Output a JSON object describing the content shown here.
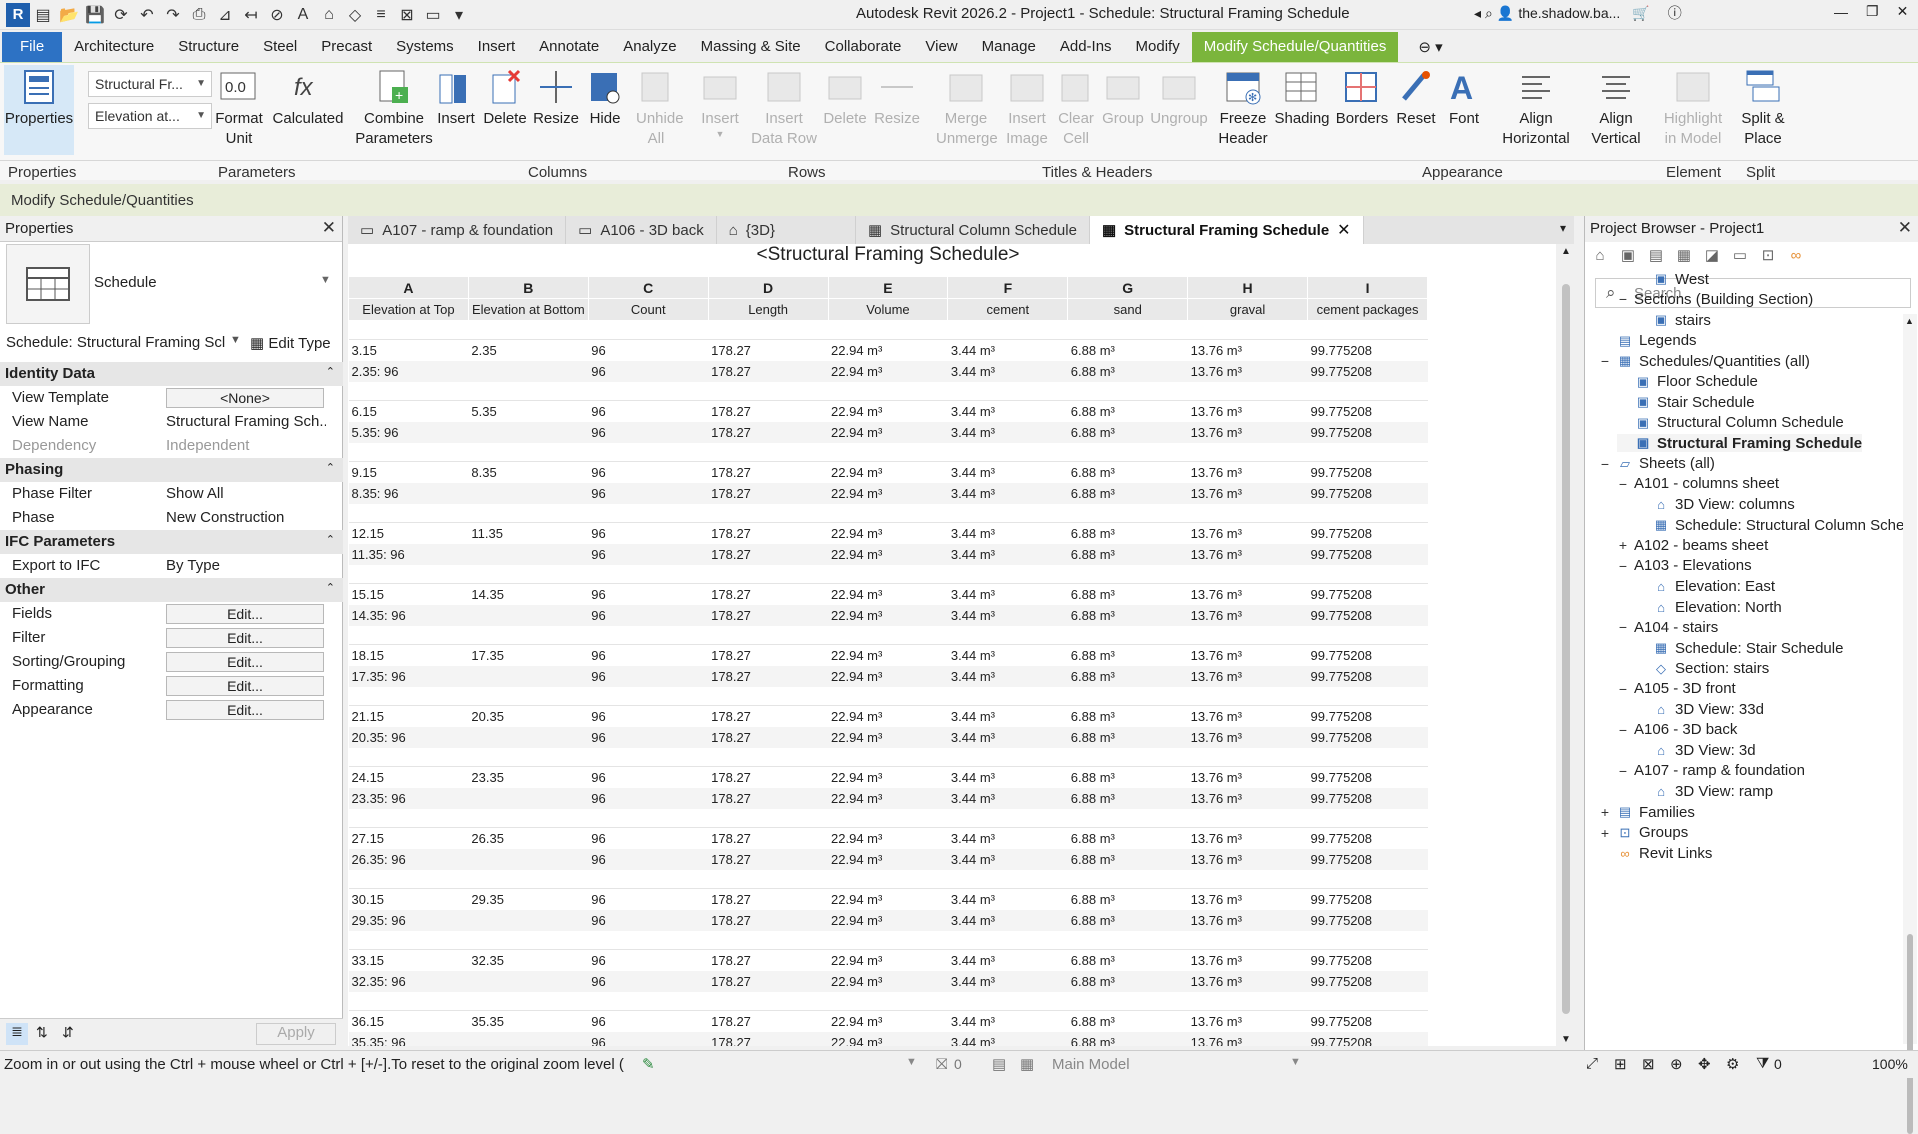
{
  "app": {
    "title": "Autodesk Revit 2026.2 - Project1 - Schedule: Structural Framing Schedule",
    "logo": "R",
    "user": "the.shadow.ba..."
  },
  "menu": [
    "File",
    "Architecture",
    "Structure",
    "Steel",
    "Precast",
    "Systems",
    "Insert",
    "Annotate",
    "Analyze",
    "Massing & Site",
    "Collaborate",
    "View",
    "Manage",
    "Add-Ins",
    "Modify",
    "Modify Schedule/Quantities"
  ],
  "ribbon": {
    "combo1": "Structural Fr...",
    "combo2": "Elevation at...",
    "buttons": {
      "properties": "Properties",
      "format_unit": "Format Unit",
      "calculated": "Calculated",
      "combine_parameters": "Combine Parameters",
      "insert": "Insert",
      "delete": "Delete",
      "resize": "Resize",
      "hide": "Hide",
      "unhide_all": "Unhide All",
      "rows_insert": "Insert",
      "insert_data_row": "Insert Data Row",
      "rows_delete": "Delete",
      "rows_resize": "Resize",
      "merge_unmerge": "Merge Unmerge",
      "insert_image": "Insert Image",
      "clear_cell": "Clear Cell",
      "group": "Group",
      "ungroup": "Ungroup",
      "freeze_header": "Freeze Header",
      "shading": "Shading",
      "borders": "Borders",
      "reset": "Reset",
      "font": "Font",
      "align_horizontal": "Align Horizontal",
      "align_vertical": "Align Vertical",
      "highlight_in_model": "Highlight in Model",
      "split_place": "Split & Place"
    },
    "panels": [
      "Properties",
      "Parameters",
      "Columns",
      "Rows",
      "Titles & Headers",
      "Appearance",
      "Element",
      "Split"
    ]
  },
  "context_bar": "Modify Schedule/Quantities",
  "properties": {
    "header": "Properties",
    "type_name": "Schedule",
    "selector": "Schedule: Structural Framing Scl",
    "edit_type": "Edit Type",
    "groups": {
      "identity": "Identity Data",
      "phasing": "Phasing",
      "ifc": "IFC Parameters",
      "other": "Other"
    },
    "rows": {
      "view_template_k": "View Template",
      "view_template_v": "<None>",
      "view_name_k": "View Name",
      "view_name_v": "Structural Framing Sch...",
      "dependency_k": "Dependency",
      "dependency_v": "Independent",
      "phase_filter_k": "Phase Filter",
      "phase_filter_v": "Show All",
      "phase_k": "Phase",
      "phase_v": "New Construction",
      "export_ifc_k": "Export to IFC",
      "export_ifc_v": "By Type",
      "fields_k": "Fields",
      "filter_k": "Filter",
      "sorting_k": "Sorting/Grouping",
      "formatting_k": "Formatting",
      "appearance_k": "Appearance",
      "edit": "Edit..."
    },
    "apply": "Apply"
  },
  "view_tabs": [
    "A107 - ramp & foundation",
    "A106 - 3D back",
    "{3D}",
    "Structural Column Schedule",
    "Structural Framing Schedule"
  ],
  "schedule": {
    "title": "<Structural Framing Schedule>",
    "letters": [
      "A",
      "B",
      "C",
      "D",
      "E",
      "F",
      "G",
      "H",
      "I"
    ],
    "headers": [
      "Elevation at Top",
      "Elevation at Bottom",
      "Count",
      "Length",
      "Volume",
      "cement",
      "sand",
      "graval",
      "cement packages"
    ],
    "groups": [
      {
        "r1": [
          "3.15",
          "2.35",
          "96",
          "178.27",
          "22.94 m³",
          "3.44 m³",
          "6.88 m³",
          "13.76 m³",
          "99.775208"
        ],
        "r2": [
          "2.35: 96",
          "",
          "96",
          "178.27",
          "22.94 m³",
          "3.44 m³",
          "6.88 m³",
          "13.76 m³",
          "99.775208"
        ]
      },
      {
        "r1": [
          "6.15",
          "5.35",
          "96",
          "178.27",
          "22.94 m³",
          "3.44 m³",
          "6.88 m³",
          "13.76 m³",
          "99.775208"
        ],
        "r2": [
          "5.35: 96",
          "",
          "96",
          "178.27",
          "22.94 m³",
          "3.44 m³",
          "6.88 m³",
          "13.76 m³",
          "99.775208"
        ]
      },
      {
        "r1": [
          "9.15",
          "8.35",
          "96",
          "178.27",
          "22.94 m³",
          "3.44 m³",
          "6.88 m³",
          "13.76 m³",
          "99.775208"
        ],
        "r2": [
          "8.35: 96",
          "",
          "96",
          "178.27",
          "22.94 m³",
          "3.44 m³",
          "6.88 m³",
          "13.76 m³",
          "99.775208"
        ]
      },
      {
        "r1": [
          "12.15",
          "11.35",
          "96",
          "178.27",
          "22.94 m³",
          "3.44 m³",
          "6.88 m³",
          "13.76 m³",
          "99.775208"
        ],
        "r2": [
          "11.35: 96",
          "",
          "96",
          "178.27",
          "22.94 m³",
          "3.44 m³",
          "6.88 m³",
          "13.76 m³",
          "99.775208"
        ]
      },
      {
        "r1": [
          "15.15",
          "14.35",
          "96",
          "178.27",
          "22.94 m³",
          "3.44 m³",
          "6.88 m³",
          "13.76 m³",
          "99.775208"
        ],
        "r2": [
          "14.35: 96",
          "",
          "96",
          "178.27",
          "22.94 m³",
          "3.44 m³",
          "6.88 m³",
          "13.76 m³",
          "99.775208"
        ]
      },
      {
        "r1": [
          "18.15",
          "17.35",
          "96",
          "178.27",
          "22.94 m³",
          "3.44 m³",
          "6.88 m³",
          "13.76 m³",
          "99.775208"
        ],
        "r2": [
          "17.35: 96",
          "",
          "96",
          "178.27",
          "22.94 m³",
          "3.44 m³",
          "6.88 m³",
          "13.76 m³",
          "99.775208"
        ]
      },
      {
        "r1": [
          "21.15",
          "20.35",
          "96",
          "178.27",
          "22.94 m³",
          "3.44 m³",
          "6.88 m³",
          "13.76 m³",
          "99.775208"
        ],
        "r2": [
          "20.35: 96",
          "",
          "96",
          "178.27",
          "22.94 m³",
          "3.44 m³",
          "6.88 m³",
          "13.76 m³",
          "99.775208"
        ]
      },
      {
        "r1": [
          "24.15",
          "23.35",
          "96",
          "178.27",
          "22.94 m³",
          "3.44 m³",
          "6.88 m³",
          "13.76 m³",
          "99.775208"
        ],
        "r2": [
          "23.35: 96",
          "",
          "96",
          "178.27",
          "22.94 m³",
          "3.44 m³",
          "6.88 m³",
          "13.76 m³",
          "99.775208"
        ]
      },
      {
        "r1": [
          "27.15",
          "26.35",
          "96",
          "178.27",
          "22.94 m³",
          "3.44 m³",
          "6.88 m³",
          "13.76 m³",
          "99.775208"
        ],
        "r2": [
          "26.35: 96",
          "",
          "96",
          "178.27",
          "22.94 m³",
          "3.44 m³",
          "6.88 m³",
          "13.76 m³",
          "99.775208"
        ]
      },
      {
        "r1": [
          "30.15",
          "29.35",
          "96",
          "178.27",
          "22.94 m³",
          "3.44 m³",
          "6.88 m³",
          "13.76 m³",
          "99.775208"
        ],
        "r2": [
          "29.35: 96",
          "",
          "96",
          "178.27",
          "22.94 m³",
          "3.44 m³",
          "6.88 m³",
          "13.76 m³",
          "99.775208"
        ]
      },
      {
        "r1": [
          "33.15",
          "32.35",
          "96",
          "178.27",
          "22.94 m³",
          "3.44 m³",
          "6.88 m³",
          "13.76 m³",
          "99.775208"
        ],
        "r2": [
          "32.35: 96",
          "",
          "96",
          "178.27",
          "22.94 m³",
          "3.44 m³",
          "6.88 m³",
          "13.76 m³",
          "99.775208"
        ]
      },
      {
        "r1": [
          "36.15",
          "35.35",
          "96",
          "178.27",
          "22.94 m³",
          "3.44 m³",
          "6.88 m³",
          "13.76 m³",
          "99.775208"
        ],
        "r2": [
          "35.35: 96",
          "",
          "96",
          "178.27",
          "22.94 m³",
          "3.44 m³",
          "6.88 m³",
          "13.76 m³",
          "99.775208"
        ]
      }
    ]
  },
  "browser": {
    "header": "Project Browser - Project1",
    "search_placeholder": "Search",
    "nodes": [
      {
        "label": "West",
        "icon": "elevation-view-icon",
        "level": 3,
        "toggle": ""
      },
      {
        "label": "Sections (Building Section)",
        "icon": "",
        "level": 2,
        "toggle": "−"
      },
      {
        "label": "stairs",
        "icon": "section-view-icon",
        "level": 3,
        "toggle": ""
      },
      {
        "label": "Legends",
        "icon": "legend-icon",
        "level": 1,
        "toggle": ""
      },
      {
        "label": "Schedules/Quantities (all)",
        "icon": "schedule-icon",
        "level": 1,
        "toggle": "−"
      },
      {
        "label": "Floor Schedule",
        "icon": "schedule-item-icon",
        "level": 2,
        "toggle": ""
      },
      {
        "label": "Stair Schedule",
        "icon": "schedule-item-icon",
        "level": 2,
        "toggle": ""
      },
      {
        "label": "Structural Column Schedule",
        "icon": "schedule-item-icon",
        "level": 2,
        "toggle": ""
      },
      {
        "label": "Structural Framing Schedule",
        "icon": "schedule-item-icon",
        "level": 2,
        "toggle": "",
        "selected": true
      },
      {
        "label": "Sheets (all)",
        "icon": "sheet-set-icon",
        "level": 1,
        "toggle": "−"
      },
      {
        "label": "A101 - columns sheet",
        "icon": "",
        "level": 2,
        "toggle": "−"
      },
      {
        "label": "3D View: columns",
        "icon": "3d-view-icon",
        "level": 3,
        "toggle": ""
      },
      {
        "label": "Schedule: Structural Column Sche",
        "icon": "schedule-icon",
        "level": 3,
        "toggle": ""
      },
      {
        "label": "A102 - beams sheet",
        "icon": "",
        "level": 2,
        "toggle": "+"
      },
      {
        "label": "A103 - Elevations",
        "icon": "",
        "level": 2,
        "toggle": "−"
      },
      {
        "label": "Elevation: East",
        "icon": "elevation-icon",
        "level": 3,
        "toggle": ""
      },
      {
        "label": "Elevation: North",
        "icon": "elevation-icon",
        "level": 3,
        "toggle": ""
      },
      {
        "label": "A104 - stairs",
        "icon": "",
        "level": 2,
        "toggle": "−"
      },
      {
        "label": "Schedule: Stair Schedule",
        "icon": "schedule-icon",
        "level": 3,
        "toggle": ""
      },
      {
        "label": "Section: stairs",
        "icon": "section-icon",
        "level": 3,
        "toggle": ""
      },
      {
        "label": "A105 - 3D front",
        "icon": "",
        "level": 2,
        "toggle": "−"
      },
      {
        "label": "3D View: 33d",
        "icon": "3d-view-icon",
        "level": 3,
        "toggle": ""
      },
      {
        "label": "A106 - 3D back",
        "icon": "",
        "level": 2,
        "toggle": "−"
      },
      {
        "label": "3D View: 3d",
        "icon": "3d-view-icon",
        "level": 3,
        "toggle": ""
      },
      {
        "label": "A107 - ramp & foundation",
        "icon": "",
        "level": 2,
        "toggle": "−"
      },
      {
        "label": "3D View: ramp",
        "icon": "3d-view-icon",
        "level": 3,
        "toggle": ""
      },
      {
        "label": "Families",
        "icon": "families-icon",
        "level": 1,
        "toggle": "+"
      },
      {
        "label": "Groups",
        "icon": "groups-icon",
        "level": 1,
        "toggle": "+"
      },
      {
        "label": "Revit Links",
        "icon": "link-icon",
        "level": 1,
        "toggle": ""
      }
    ]
  },
  "status": {
    "message": "Zoom in or out using the Ctrl + mouse wheel or Ctrl + [+/-].To reset to the original zoom level (",
    "worksets": "0",
    "model": "Main Model",
    "filter_count": "0",
    "zoom": "100%"
  }
}
